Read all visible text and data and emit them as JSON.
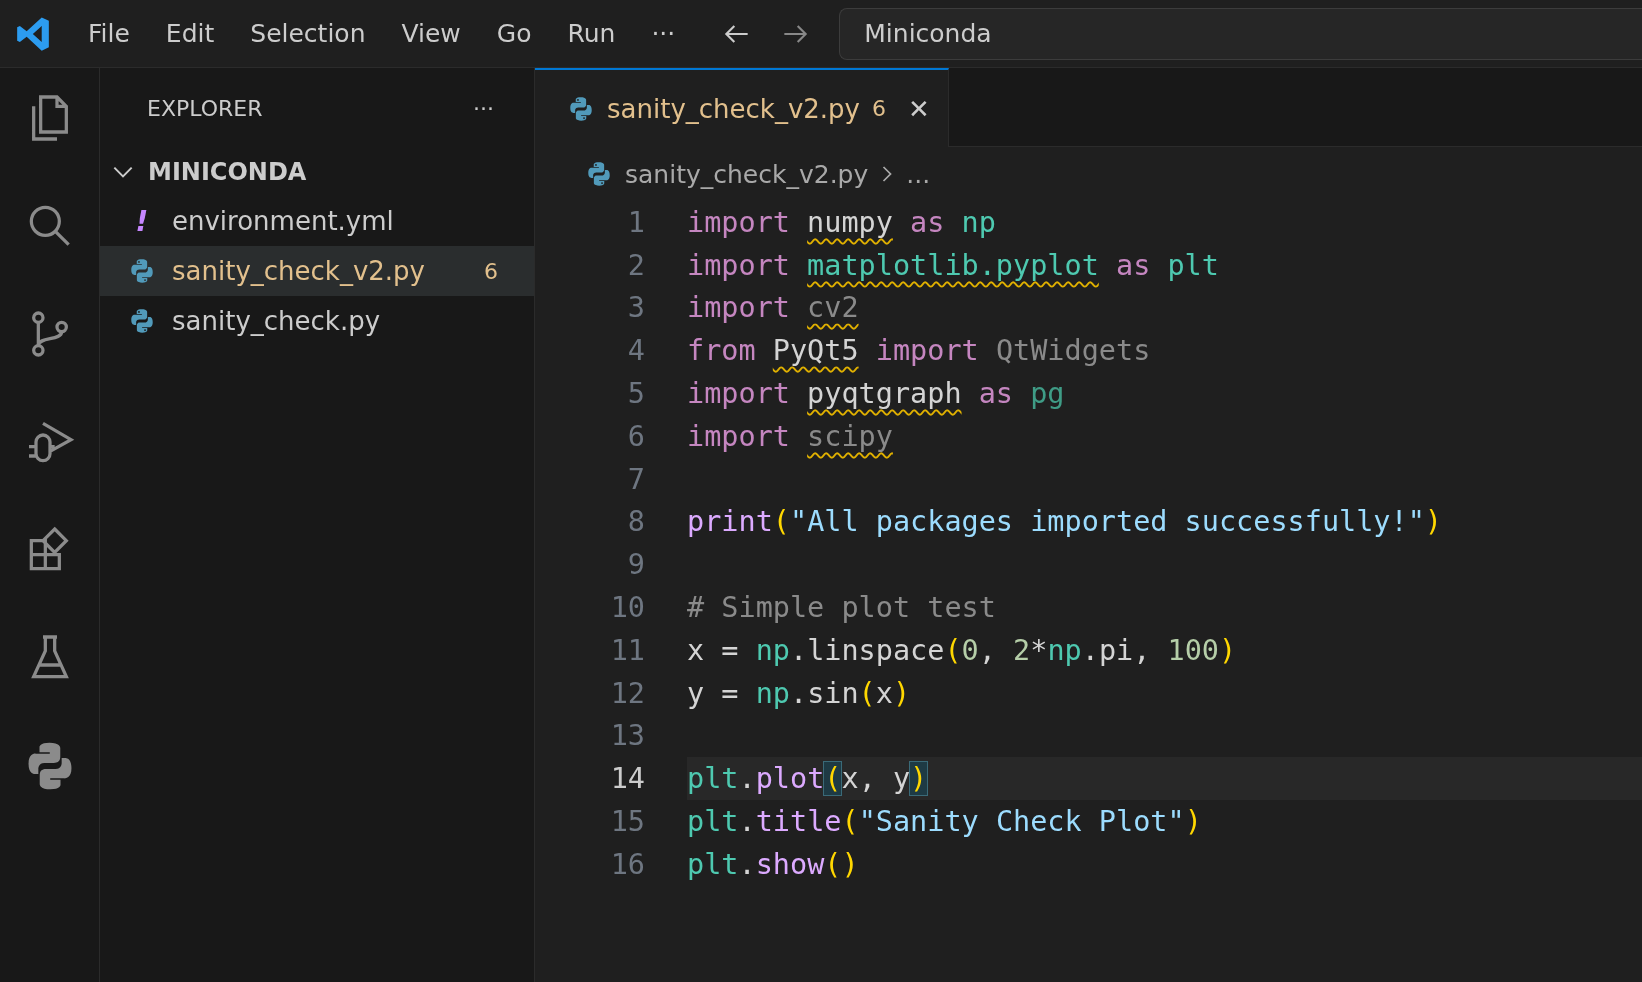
{
  "menu": [
    "File",
    "Edit",
    "Selection",
    "View",
    "Go",
    "Run",
    "···"
  ],
  "search": {
    "value": "Miniconda"
  },
  "activity_bar": [
    {
      "kind": "files",
      "selected": false
    },
    {
      "kind": "search",
      "selected": false
    },
    {
      "kind": "source-control",
      "selected": false
    },
    {
      "kind": "run-debug",
      "selected": false
    },
    {
      "kind": "extensions",
      "selected": false
    },
    {
      "kind": "testing",
      "selected": false
    },
    {
      "kind": "python",
      "selected": false
    }
  ],
  "explorer": {
    "title": "EXPLORER",
    "more": "···",
    "folder": {
      "name": "MINICONDA",
      "expanded": true
    },
    "files": [
      {
        "name": "environment.yml",
        "kind": "yaml",
        "icon_text": "!",
        "selected": false
      },
      {
        "name": "sanity_check_v2.py",
        "kind": "python",
        "selected": true,
        "problems": "6"
      },
      {
        "name": "sanity_check.py",
        "kind": "python",
        "selected": false
      }
    ]
  },
  "tabs": [
    {
      "name": "sanity_check_v2.py",
      "problems": "6",
      "close": "✕",
      "selected": true
    }
  ],
  "breadcrumb": {
    "file": "sanity_check_v2.py",
    "rest": "..."
  },
  "lines": [
    {
      "number": "1",
      "current": false,
      "tokens": [
        {
          "text": "import ",
          "kind": "keyword"
        },
        {
          "text": "numpy",
          "kind": "plain",
          "squiggle": true
        },
        {
          "text": " as ",
          "kind": "keyword"
        },
        {
          "text": "np",
          "kind": "module"
        }
      ]
    },
    {
      "number": "2",
      "current": false,
      "tokens": [
        {
          "text": "import ",
          "kind": "keyword"
        },
        {
          "text": "matplotlib.pyplot",
          "kind": "module",
          "squiggle": true
        },
        {
          "text": " as ",
          "kind": "keyword"
        },
        {
          "text": "plt",
          "kind": "module"
        }
      ]
    },
    {
      "number": "3",
      "current": false,
      "tokens": [
        {
          "text": "import ",
          "kind": "keyword"
        },
        {
          "text": "cv2",
          "kind": "faded",
          "squiggle": true
        }
      ]
    },
    {
      "number": "4",
      "current": false,
      "tokens": [
        {
          "text": "from ",
          "kind": "keyword"
        },
        {
          "text": "PyQt5",
          "kind": "plain",
          "squiggle": true
        },
        {
          "text": " import ",
          "kind": "keyword"
        },
        {
          "text": "QtWidgets",
          "kind": "faded"
        }
      ]
    },
    {
      "number": "5",
      "current": false,
      "tokens": [
        {
          "text": "import ",
          "kind": "keyword"
        },
        {
          "text": "pyqtgraph",
          "kind": "plain",
          "squiggle": true
        },
        {
          "text": " as ",
          "kind": "keyword"
        },
        {
          "text": "pg",
          "kind": "alias"
        }
      ]
    },
    {
      "number": "6",
      "current": false,
      "tokens": [
        {
          "text": "import ",
          "kind": "keyword"
        },
        {
          "text": "scipy",
          "kind": "faded",
          "squiggle": true
        }
      ]
    },
    {
      "number": "7",
      "current": false
    },
    {
      "number": "8",
      "current": false,
      "tokens": [
        {
          "text": "print",
          "kind": "func"
        },
        {
          "text": "(",
          "kind": "bracket"
        },
        {
          "text": "\"All packages imported successfully!\"",
          "kind": "string"
        },
        {
          "text": ")",
          "kind": "bracket"
        }
      ]
    },
    {
      "number": "9",
      "current": false
    },
    {
      "number": "10",
      "current": false,
      "tokens": [
        {
          "text": "# Simple plot test",
          "kind": "comment"
        }
      ]
    },
    {
      "number": "11",
      "current": false,
      "tokens": [
        {
          "text": "x = ",
          "kind": "plain"
        },
        {
          "text": "np",
          "kind": "module"
        },
        {
          "text": ".linspace",
          "kind": "plain"
        },
        {
          "text": "(",
          "kind": "bracket"
        },
        {
          "text": "0",
          "kind": "number"
        },
        {
          "text": ", ",
          "kind": "plain"
        },
        {
          "text": "2",
          "kind": "number"
        },
        {
          "text": "*",
          "kind": "plain"
        },
        {
          "text": "np",
          "kind": "module"
        },
        {
          "text": ".pi, ",
          "kind": "plain"
        },
        {
          "text": "100",
          "kind": "number"
        },
        {
          "text": ")",
          "kind": "bracket"
        }
      ]
    },
    {
      "number": "12",
      "current": false,
      "tokens": [
        {
          "text": "y = ",
          "kind": "plain"
        },
        {
          "text": "np",
          "kind": "module"
        },
        {
          "text": ".sin",
          "kind": "plain"
        },
        {
          "text": "(",
          "kind": "bracket"
        },
        {
          "text": "x",
          "kind": "plain"
        },
        {
          "text": ")",
          "kind": "bracket"
        }
      ]
    },
    {
      "number": "13",
      "current": false
    },
    {
      "number": "14",
      "current": true,
      "tokens": [
        {
          "text": "plt",
          "kind": "module"
        },
        {
          "text": ".",
          "kind": "plain"
        },
        {
          "text": "plot",
          "kind": "func"
        },
        {
          "text": "(",
          "kind": "bracket-match"
        },
        {
          "text": "x, y",
          "kind": "plain"
        },
        {
          "text": ")",
          "kind": "bracket-match"
        }
      ]
    },
    {
      "number": "15",
      "current": false,
      "tokens": [
        {
          "text": "plt",
          "kind": "module"
        },
        {
          "text": ".",
          "kind": "plain"
        },
        {
          "text": "title",
          "kind": "func"
        },
        {
          "text": "(",
          "kind": "bracket"
        },
        {
          "text": "\"Sanity Check Plot\"",
          "kind": "string"
        },
        {
          "text": ")",
          "kind": "bracket"
        }
      ]
    },
    {
      "number": "16",
      "current": false,
      "tokens": [
        {
          "text": "plt",
          "kind": "module"
        },
        {
          "text": ".",
          "kind": "plain"
        },
        {
          "text": "show",
          "kind": "func"
        },
        {
          "text": "()",
          "kind": "bracket"
        }
      ]
    }
  ]
}
